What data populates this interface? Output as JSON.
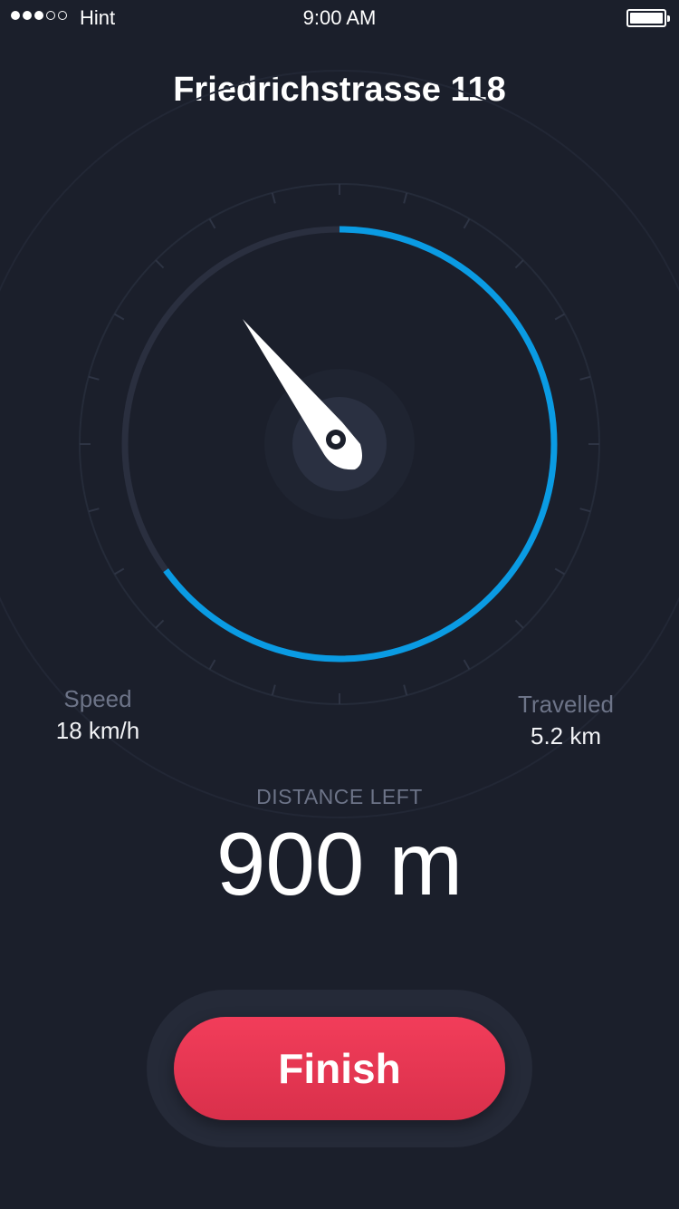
{
  "status_bar": {
    "carrier": "Hint",
    "time": "9:00 AM",
    "signal_bars_filled": 3,
    "signal_bars_total": 5,
    "battery_level": 1.0
  },
  "header": {
    "title": "Friedrichstrasse 118"
  },
  "gauge": {
    "progress_fraction": 0.65,
    "progress_color": "#0a9be3",
    "track_color": "#2a2f3f",
    "needle_icon": "compass-needle-icon"
  },
  "stats": {
    "speed": {
      "label": "Speed",
      "value": "18 km/h"
    },
    "travelled": {
      "label": "Travelled",
      "value": "5.2 km"
    }
  },
  "distance": {
    "label": "DISTANCE LEFT",
    "value": "900 m"
  },
  "actions": {
    "finish_label": "Finish",
    "finish_color": "#ee3a56"
  }
}
